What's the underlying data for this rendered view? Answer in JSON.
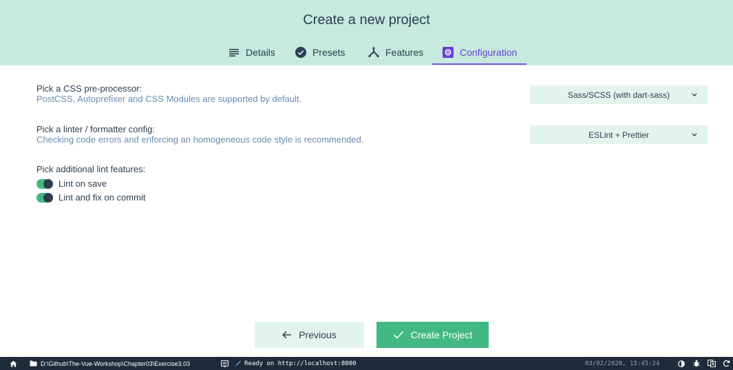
{
  "header": {
    "title": "Create a new project",
    "tabs": [
      {
        "label": "Details",
        "icon": "list-icon"
      },
      {
        "label": "Presets",
        "icon": "check-circle-icon"
      },
      {
        "label": "Features",
        "icon": "fork-icon"
      },
      {
        "label": "Configuration",
        "icon": "gear-box-icon",
        "active": true
      }
    ]
  },
  "config": {
    "css": {
      "title": "Pick a CSS pre-processor:",
      "description": "PostCSS, Autoprefixer and CSS Modules are supported by default.",
      "value": "Sass/SCSS (with dart-sass)"
    },
    "linter": {
      "title": "Pick a linter / formatter config:",
      "description": "Checking code errors and enforcing an homogeneous code style is recommended.",
      "value": "ESLint + Prettier"
    },
    "lint_features": {
      "title": "Pick additional lint features:",
      "options": [
        {
          "label": "Lint on save",
          "enabled": true
        },
        {
          "label": "Lint and fix on commit",
          "enabled": true
        }
      ]
    }
  },
  "actions": {
    "previous_label": "Previous",
    "create_label": "Create Project"
  },
  "statusbar": {
    "path": "D:\\Github\\The-Vue-Workshop\\Chapter03\\Exercise3.03",
    "status": "Ready on http://localhost:8000",
    "timestamp": "03/02/2020, 15:45:24"
  },
  "colors": {
    "header_bg": "#c6eadd",
    "accent_purple": "#7f52e0",
    "primary_green": "#42b983",
    "statusbar_bg": "#1d2b3a"
  }
}
